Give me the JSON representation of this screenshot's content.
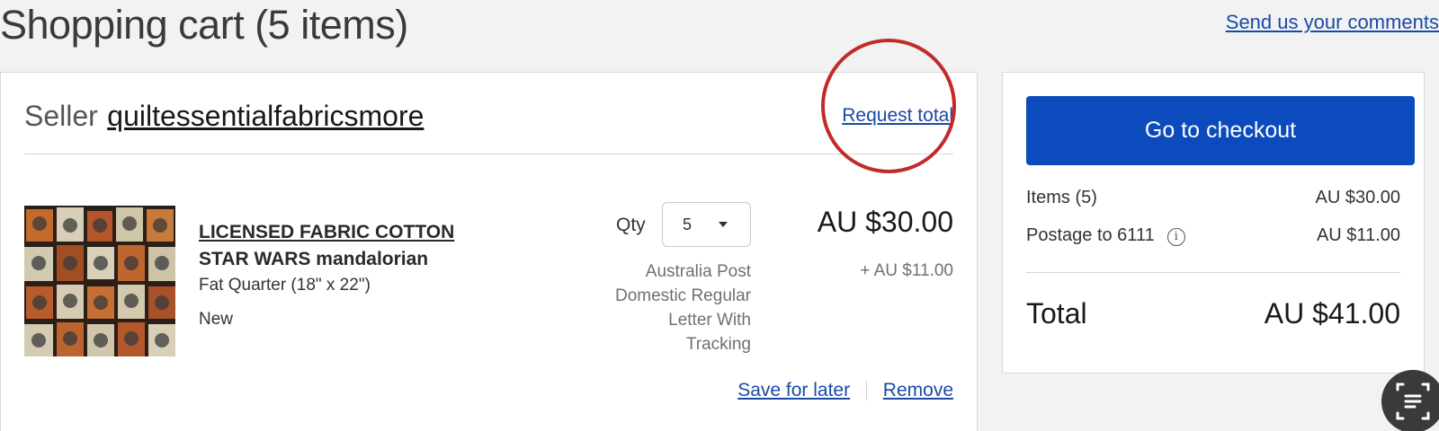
{
  "page": {
    "title": "Shopping cart (5 items)",
    "feedback_link": "Send us your comments"
  },
  "seller": {
    "label": "Seller",
    "name": "quiltessentialfabricsmore",
    "request_total": "Request total"
  },
  "item": {
    "title": "LICENSED FABRIC COTTON",
    "subtitle": "STAR WARS mandalorian",
    "variant": "Fat Quarter (18\" x 22\")",
    "condition": "New",
    "qty_label": "Qty",
    "qty_value": "5",
    "shipping_method": [
      "Australia Post",
      "Domestic Regular",
      "Letter With",
      "Tracking"
    ],
    "price": "AU $30.00",
    "postage": "+ AU $11.00",
    "save_for_later": "Save for later",
    "remove": "Remove"
  },
  "summary": {
    "checkout_label": "Go to checkout",
    "items_label": "Items (5)",
    "items_value": "AU $30.00",
    "postage_label": "Postage to 6111",
    "postage_value": "AU $11.00",
    "total_label": "Total",
    "total_value": "AU $41.00"
  },
  "colors": {
    "accent": "#0b4bbd",
    "link": "#1a4aa6",
    "annotation": "#c22a2a",
    "background": "#f2f2f2"
  },
  "icons": {
    "info": "info-icon",
    "caret": "chevron-down-icon",
    "scan": "scan-text-icon"
  }
}
